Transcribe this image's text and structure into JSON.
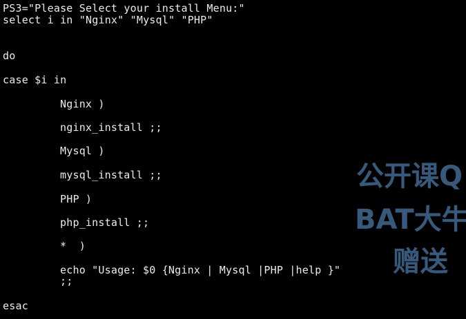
{
  "terminal": {
    "lines": [
      "PS3=\"Please Select your install Menu:\"",
      "select i in \"Nginx\" \"Mysql\" \"PHP\"",
      "do",
      "case $i in",
      "Nginx )",
      "nginx_install ;;",
      "Mysql )",
      "mysql_install ;;",
      "PHP )",
      "php_install ;;",
      "*  )",
      "echo \"Usage: $0 {Nginx | Mysql |PHP |help }\"",
      ";;",
      "esac"
    ]
  },
  "watermark": {
    "line1": "公开课Q",
    "line2": "BAT大牛",
    "line3": "赠送"
  },
  "colors": {
    "background": "#000000",
    "text": "#ECECEC",
    "watermark": "#3A5F83"
  }
}
